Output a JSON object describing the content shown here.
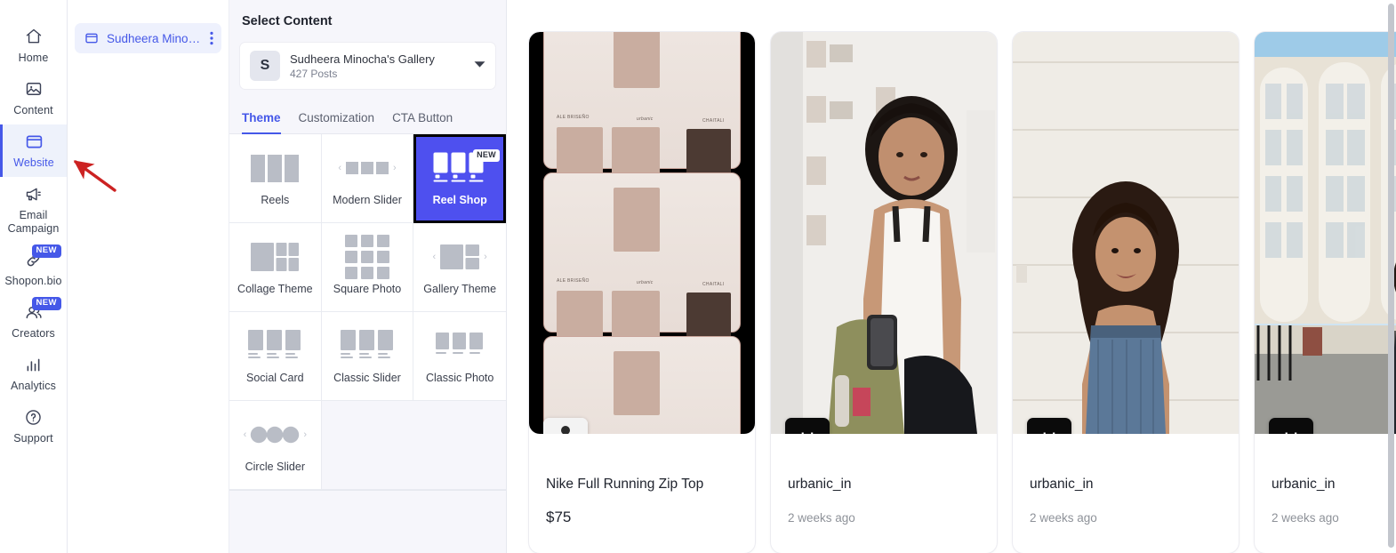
{
  "sidebar": {
    "items": [
      {
        "label": "Home",
        "icon": "home-icon",
        "active": false,
        "badge": null
      },
      {
        "label": "Content",
        "icon": "image-icon",
        "active": false,
        "badge": null
      },
      {
        "label": "Website",
        "icon": "window-icon",
        "active": true,
        "badge": null
      },
      {
        "label": "Email Campaign",
        "icon": "megaphone-icon",
        "active": false,
        "badge": null
      },
      {
        "label": "Shopon.bio",
        "icon": "link-icon",
        "active": false,
        "badge": "NEW"
      },
      {
        "label": "Creators",
        "icon": "users-icon",
        "active": false,
        "badge": "NEW"
      },
      {
        "label": "Analytics",
        "icon": "bar-chart-icon",
        "active": false,
        "badge": null
      },
      {
        "label": "Support",
        "icon": "help-circle-icon",
        "active": false,
        "badge": null
      }
    ],
    "accent_color": "#4558e8",
    "active_bg": "#eef2fb"
  },
  "workspace_tab": {
    "name": "Sudheera Minoc...",
    "icon": "window-icon",
    "menu_icon": "kebab-menu-icon"
  },
  "annotation": {
    "type": "arrow",
    "color": "#cc2222",
    "points_to": "Website"
  },
  "panel": {
    "title": "Select Content",
    "gallery": {
      "avatar_letter": "S",
      "name": "Sudheera Minocha's Gallery",
      "subtitle": "427 Posts",
      "caret_icon": "chevron-down-icon"
    },
    "tabs": [
      {
        "label": "Theme",
        "active": true
      },
      {
        "label": "Customization",
        "active": false
      },
      {
        "label": "CTA Button",
        "active": false
      }
    ],
    "themes": [
      {
        "label": "Reels",
        "art": "three-bars",
        "selected": false,
        "badge": null
      },
      {
        "label": "Modern Slider",
        "art": "three-squares-arrows",
        "selected": false,
        "badge": null
      },
      {
        "label": "Reel Shop",
        "art": "reel-shop",
        "selected": true,
        "badge": "NEW"
      },
      {
        "label": "Collage Theme",
        "art": "collage",
        "selected": false,
        "badge": null
      },
      {
        "label": "Square Photo",
        "art": "grid-nine",
        "selected": false,
        "badge": null
      },
      {
        "label": "Gallery Theme",
        "art": "gallery-arrows",
        "selected": false,
        "badge": null
      },
      {
        "label": "Social Card",
        "art": "three-cards-lines",
        "selected": false,
        "badge": null
      },
      {
        "label": "Classic Slider",
        "art": "three-cards-lines",
        "selected": false,
        "badge": null
      },
      {
        "label": "Classic Photo",
        "art": "three-small-cards",
        "selected": false,
        "badge": null
      },
      {
        "label": "Circle Slider",
        "art": "three-circles-arrows",
        "selected": false,
        "badge": null
      }
    ],
    "selected_theme": "Reel Shop",
    "selected_color": "#4e50ef"
  },
  "preview": {
    "cards": [
      {
        "kind": "product",
        "avatar_kind": "photo",
        "avatar_letter": "",
        "title": "Nike Full Running Zip Top",
        "price": "$75",
        "meta": ""
      },
      {
        "kind": "post",
        "avatar_kind": "letter",
        "avatar_letter": "U",
        "title": "urbanic_in",
        "price": "",
        "meta": "2 weeks ago"
      },
      {
        "kind": "post",
        "avatar_kind": "letter",
        "avatar_letter": "U",
        "title": "urbanic_in",
        "price": "",
        "meta": "2 weeks ago"
      },
      {
        "kind": "post",
        "avatar_kind": "letter",
        "avatar_letter": "U",
        "title": "urbanic_in",
        "price": "",
        "meta": "2 weeks ago"
      }
    ]
  },
  "contact_sheet_labels": [
    "ALE BRISEÑO",
    "urbanic",
    "CHAITALI"
  ]
}
